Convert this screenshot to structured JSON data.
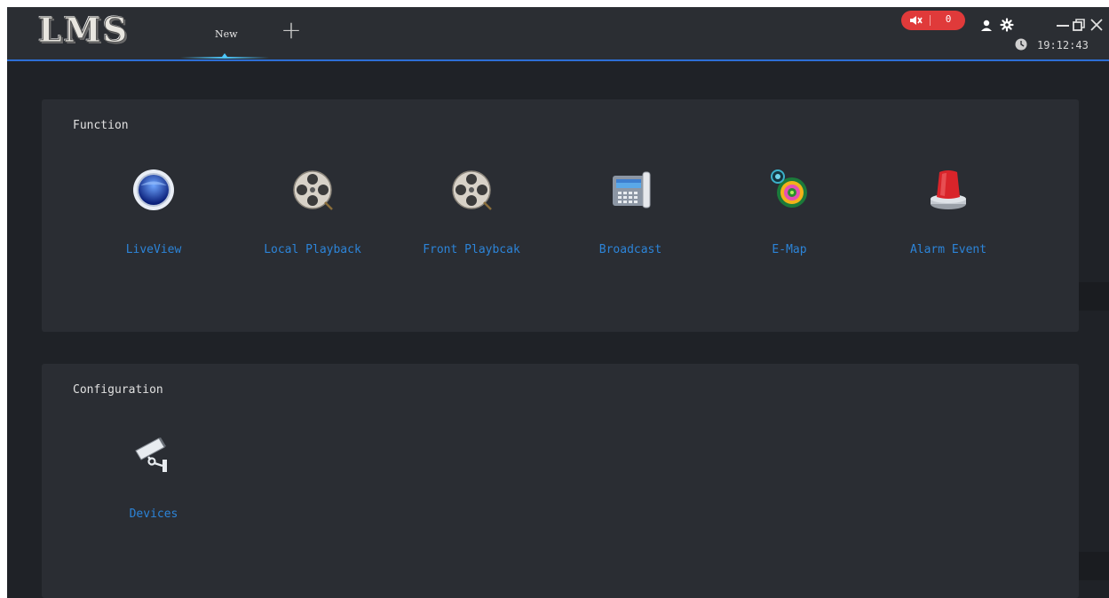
{
  "app": {
    "logo_text": "LMS"
  },
  "tabs": [
    {
      "label": "New"
    }
  ],
  "add_tab_symbol": "+",
  "header": {
    "alarm_count": "0",
    "time": "19:12:43",
    "icons": [
      "mute-icon",
      "user-icon",
      "gear-icon",
      "minimize-icon",
      "restore-icon",
      "close-icon",
      "clock-icon"
    ]
  },
  "function_section": {
    "title": "Function",
    "items": [
      {
        "label": "LiveView",
        "icon": "liveview-icon"
      },
      {
        "label": "Local Playback",
        "icon": "film-reel-icon"
      },
      {
        "label": "Front Playbcak",
        "icon": "film-reel-icon"
      },
      {
        "label": "Broadcast",
        "icon": "telephone-icon"
      },
      {
        "label": "E-Map",
        "icon": "map-target-icon"
      },
      {
        "label": "Alarm Event",
        "icon": "alarm-light-icon"
      }
    ]
  },
  "configuration_section": {
    "title": "Configuration",
    "items": [
      {
        "label": "Devices",
        "icon": "camera-icon"
      }
    ]
  },
  "colors": {
    "accent": "#2d6fd6",
    "link": "#2c84d8",
    "alarm": "#e03a3a",
    "panel": "#2a2d33",
    "background": "#1f2227"
  }
}
